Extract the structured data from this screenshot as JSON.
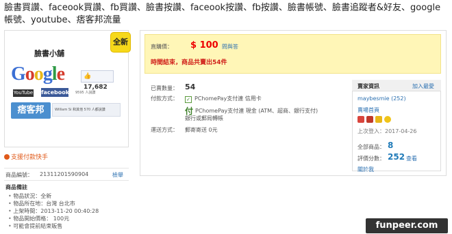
{
  "page": {
    "title": "臉書買讚、faceook買讚、fb買讚、臉書按讚、faceook按讚、fb按讚、臉書帳號、臉書追蹤者&好友、google帳號、youtube、痞客邦流量"
  },
  "product": {
    "badge": "全新",
    "image": {
      "shop_name": "臉書小舖",
      "google_text": {
        "g1": "G",
        "o1": "o",
        "o2": "o",
        "g2": "g",
        "l": "l",
        "e": "e"
      },
      "like_count": "17,682",
      "youtube_label": "YouTube",
      "facebook_label": "facebook",
      "small_like_text": "9595 人說讚",
      "pixnet_label": "痞客邦",
      "fb_bar_text": "William Si 和其他 570 人都說讚"
    },
    "pay_fast": "支援付款快手",
    "item_no_label": "商品編號：",
    "item_no": "21311201590904",
    "report_label": "檢舉",
    "notes_title": "商品備註",
    "notes": [
      "物品狀況：全新",
      "物品所在地：台灣 台北市",
      "上架時間：2013-11-20 00:40:28",
      "物品開始價格： 100元",
      "可能會提前結束販售"
    ]
  },
  "pricing": {
    "price_label": "直購價：",
    "price_value": "$ 100",
    "ask_link": "問與答",
    "ended_text": "時間結束，商品共賣出54件"
  },
  "details": {
    "sold_label": "已賣數量：",
    "sold_value": "54",
    "pay_label": "付款方式：",
    "pay_options": [
      "PChomePay支付連 信用卡",
      "PChomePay支付連 現金 (ATM、超商、銀行支付)",
      "銀行或郵局轉帳"
    ],
    "ship_label": "運送方式：",
    "ship_value": "郵寄寄送 0元"
  },
  "seller": {
    "title": "賣家資訊",
    "add_fav": "加入最愛",
    "name": "maybesmie (252)",
    "home": "賣場首頁",
    "last_login": "上次登入：2017-04-26",
    "total_label": "全部商品：",
    "total_value": "8",
    "rating_label": "評價分數：",
    "rating_value": "252",
    "rating_link": "查看",
    "about": "關於我"
  },
  "watermark": "funpeer.com"
}
